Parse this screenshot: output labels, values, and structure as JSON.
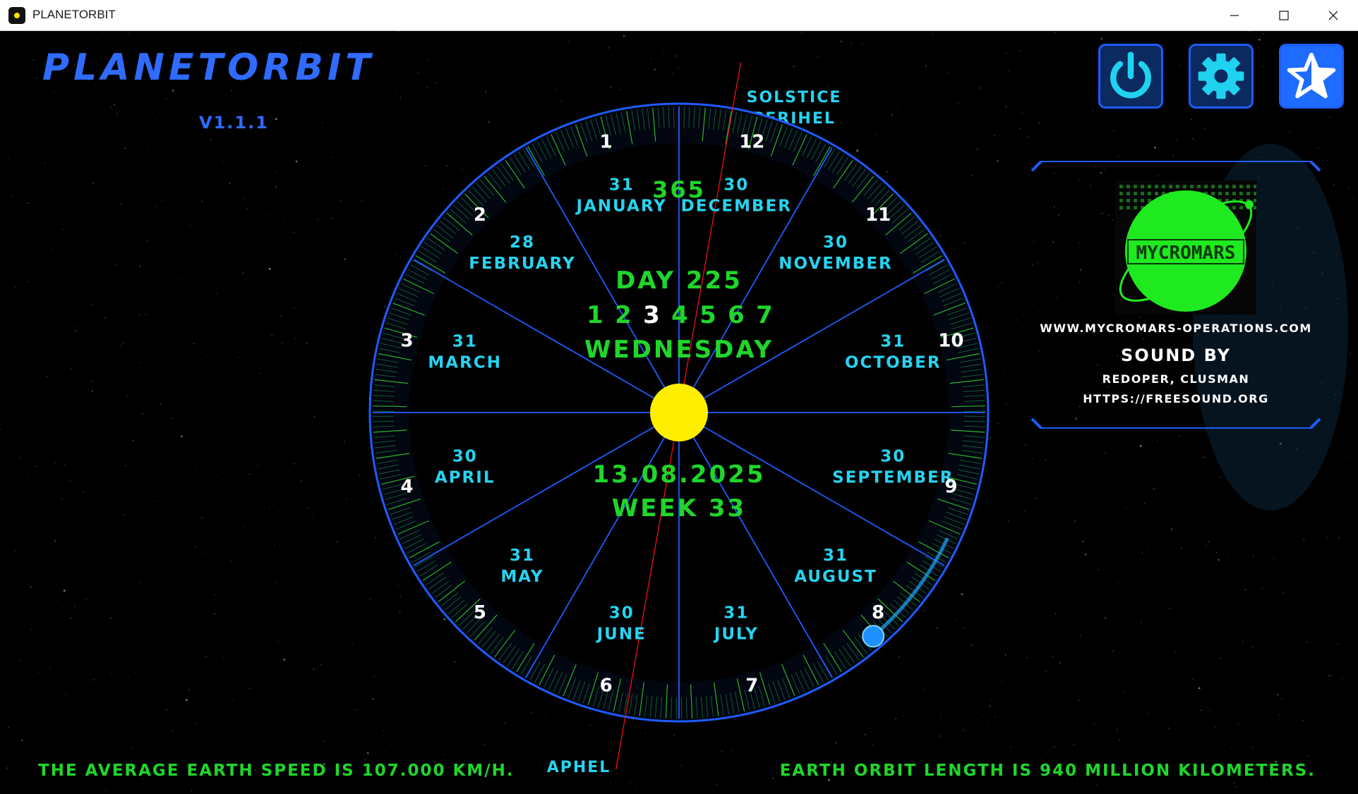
{
  "window": {
    "title": "PLANETORBIT"
  },
  "app": {
    "title": "PLANETORBIT",
    "version": "V1.1.1"
  },
  "toolbar": {
    "power_icon": "power-icon",
    "settings_icon": "gear-icon",
    "favorite_icon": "star-icon"
  },
  "orbit": {
    "solstice_line1": "SOLSTICE",
    "solstice_line2": "PERIHEL",
    "aphel": "APHEL",
    "days_in_year": "365",
    "day_label": "DAY 225",
    "weekdays": [
      "1",
      "2",
      "3",
      "4",
      "5",
      "6",
      "7"
    ],
    "current_weekday_index": 2,
    "weekday_name": "WEDNESDAY",
    "date": "13.08.2025",
    "week": "WEEK 33",
    "year_fraction": 0.6137,
    "months": [
      {
        "name": "JANUARY",
        "days": "31"
      },
      {
        "name": "FEBRUARY",
        "days": "28"
      },
      {
        "name": "MARCH",
        "days": "31"
      },
      {
        "name": "APRIL",
        "days": "30"
      },
      {
        "name": "MAY",
        "days": "31"
      },
      {
        "name": "JUNE",
        "days": "30"
      },
      {
        "name": "JULY",
        "days": "31"
      },
      {
        "name": "AUGUST",
        "days": "31"
      },
      {
        "name": "SEPTEMBER",
        "days": "30"
      },
      {
        "name": "OCTOBER",
        "days": "31"
      },
      {
        "name": "NOVEMBER",
        "days": "30"
      },
      {
        "name": "DECEMBER",
        "days": "30"
      }
    ],
    "month_numbers": [
      "1",
      "2",
      "3",
      "4",
      "5",
      "6",
      "7",
      "8",
      "9",
      "10",
      "11",
      "12"
    ]
  },
  "credits": {
    "logo_text": "MYCROMARS",
    "url": "WWW.MYCROMARS-OPERATIONS.COM",
    "sound_by": "SOUND BY",
    "sound_names": "REDOPER, CLUSMAN",
    "sound_link": "HTTPS://FREESOUND.ORG"
  },
  "footer": {
    "speed_text": "THE AVERAGE EARTH SPEED IS 107.000 KM/H.",
    "orbit_text": "EARTH ORBIT LENGTH IS 940 MILLION KILOMETERS."
  },
  "colors": {
    "title_blue": "#2f6bff",
    "cyan": "#27d3f0",
    "green": "#1fd62a",
    "sun": "#ffee00",
    "earth": "#1e90ff"
  }
}
